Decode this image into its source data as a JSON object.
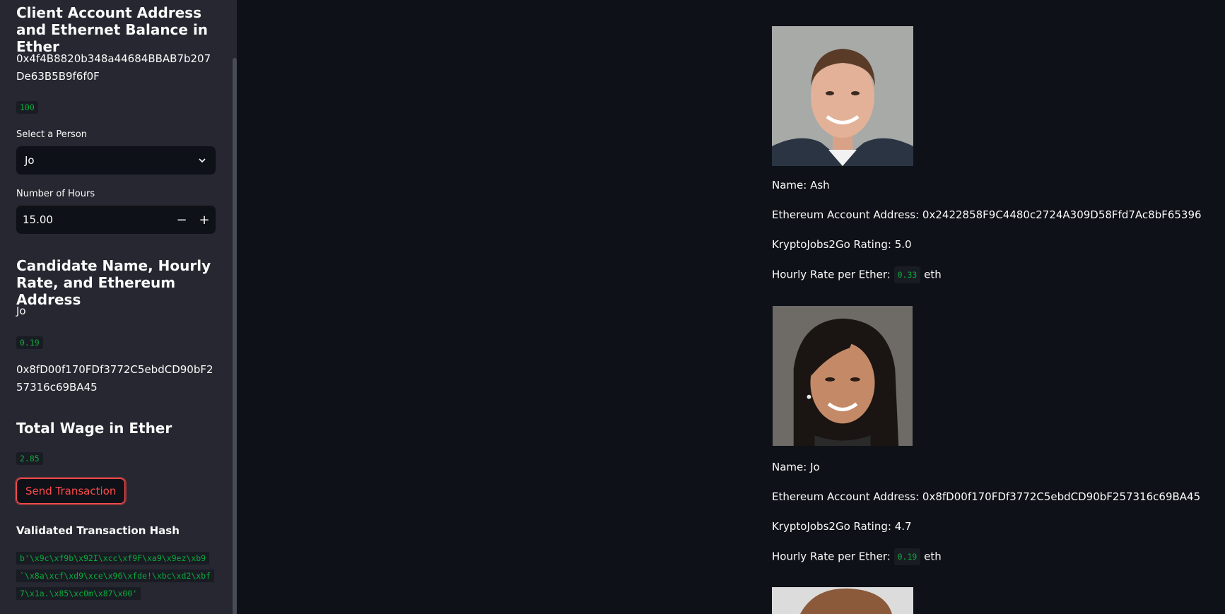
{
  "sidebar": {
    "client_heading": "Client Account Address and Ethernet Balance in Ether",
    "client_address": "0x4f4B8820b348a44684BBAB7b207De63B5B9f6f0F",
    "client_balance": "100",
    "select_label": "Select a Person",
    "select_value": "Jo",
    "hours_label": "Number of Hours",
    "hours_value": "15.00",
    "candidate_heading": "Candidate Name, Hourly Rate, and Ethereum Address",
    "candidate_name": "Jo",
    "candidate_rate": "0.19",
    "candidate_address": "0x8fD00f170FDf3772C5ebdCD90bF257316c69BA45",
    "wage_heading": "Total Wage in Ether",
    "wage_value": "2.85",
    "send_button": "Send Transaction",
    "hash_heading": "Validated Transaction Hash",
    "hash_lines": [
      "b'\\x9c\\xf9b\\x92I\\xcc\\xf9F\\xa9\\x9ez\\xb9",
      "`\\x8a\\xcf\\xd9\\xce\\x96\\xfde!\\xbc\\xd2\\xbf",
      "7\\x1a.\\x85\\xc0m\\x87\\x00'"
    ]
  },
  "candidates": [
    {
      "name": "Name: Ash",
      "address": "Ethereum Account Address: 0x2422858F9C4480c2724A309D58Ffd7Ac8bF65396",
      "rating": "KryptoJobs2Go Rating: 5.0",
      "rate_label": "Hourly Rate per Ether:",
      "rate": "0.33",
      "unit": "eth"
    },
    {
      "name": "Name: Jo",
      "address": "Ethereum Account Address: 0x8fD00f170FDf3772C5ebdCD90bF257316c69BA45",
      "rating": "KryptoJobs2Go Rating: 4.7",
      "rate_label": "Hourly Rate per Ether:",
      "rate": "0.19",
      "unit": "eth"
    }
  ],
  "colors": {
    "background": "#0e1117",
    "sidebar": "#262730",
    "accent": "#ff4b4b",
    "code": "#09ab3b"
  }
}
